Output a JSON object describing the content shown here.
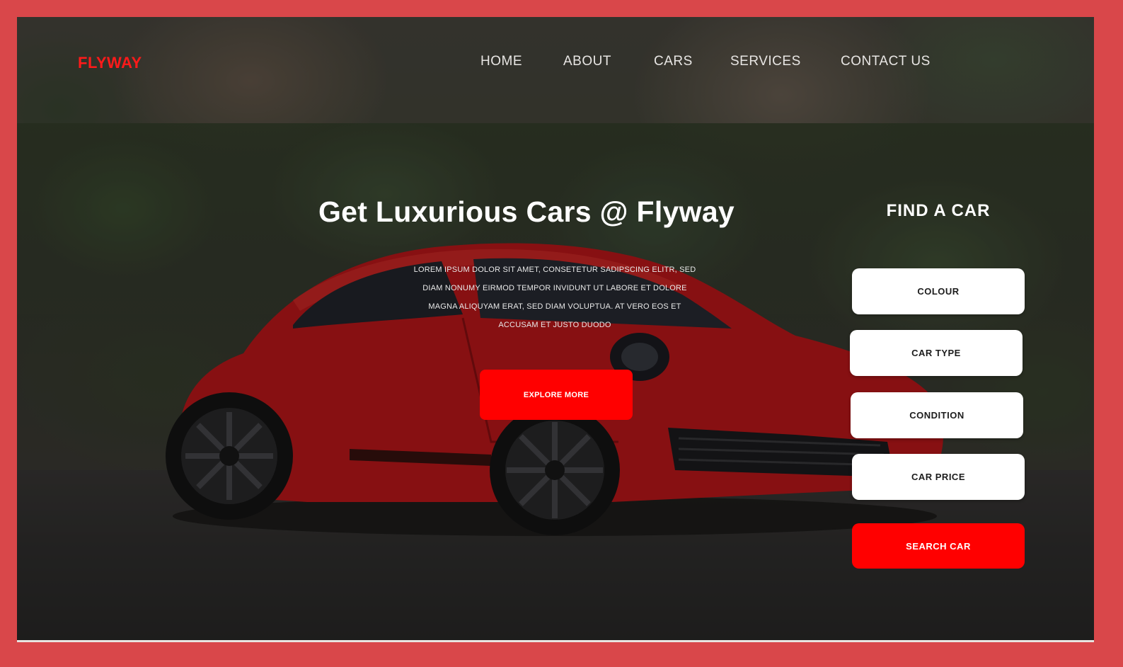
{
  "brand": {
    "logo": "FLYWAY"
  },
  "nav": {
    "home": "HOME",
    "about": "ABOUT",
    "cars": "CARS",
    "services": "SERVICES",
    "contact": "CONTACT US"
  },
  "hero": {
    "title": "Get Luxurious Cars @ Flyway",
    "text": "LOREM IPSUM DOLOR SIT AMET, CONSETETUR SADIPSCING ELITR, SED DIAM NONUMY EIRMOD TEMPOR INVIDUNT UT LABORE ET DOLORE MAGNA ALIQUYAM ERAT, SED DIAM VOLUPTUA. AT VERO EOS ET ACCUSAM ET JUSTO DUODO",
    "button": "EXPLORE MORE"
  },
  "finder": {
    "title": "FIND A CAR",
    "fields": [
      "COLOUR",
      "CAR TYPE",
      "CONDITION",
      "CAR PRICE"
    ],
    "search_button": "SEARCH CAR"
  },
  "colors": {
    "accent": "#ff0000",
    "border": "#d9474a",
    "car": "#c8191b"
  },
  "icons": {
    "car": "car-image"
  }
}
